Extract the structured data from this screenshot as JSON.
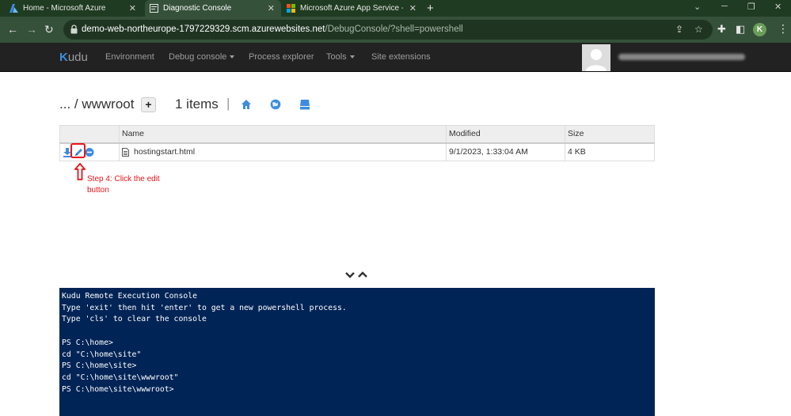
{
  "browser": {
    "tabs": [
      {
        "title": "Home - Microsoft Azure",
        "active": false
      },
      {
        "title": "Diagnostic Console",
        "active": true
      },
      {
        "title": "Microsoft Azure App Service - W",
        "active": false
      }
    ],
    "url_host": "demo-web-northeurope-1797229329.scm.azurewebsites.net",
    "url_path": "/DebugConsole/?shell=powershell",
    "profile_initial": "K"
  },
  "kudu_nav": {
    "brand_k": "K",
    "brand_rest": "udu",
    "links": [
      "Environment",
      "Debug console",
      "Process explorer",
      "Tools",
      "Site extensions"
    ]
  },
  "breadcrumb": {
    "path": "... / wwwroot",
    "items_count": "1 items"
  },
  "file_table": {
    "headers": [
      "",
      "Name",
      "Modified",
      "Size"
    ],
    "rows": [
      {
        "name": "hostingstart.html",
        "modified": "9/1/2023, 1:33:04 AM",
        "size": "4 KB"
      }
    ]
  },
  "annotation": {
    "text": "Step 4: Click the edit button",
    "color": "#e8141b"
  },
  "console": {
    "lines": [
      "Kudu Remote Execution Console",
      "Type 'exit' then hit 'enter' to get a new powershell process.",
      "Type 'cls' to clear the console",
      "",
      "PS C:\\home>",
      "cd \"C:\\home\\site\"",
      "PS C:\\home\\site>",
      "cd \"C:\\home\\site\\wwwroot\"",
      "PS C:\\home\\site\\wwwroot>"
    ]
  },
  "colors": {
    "browser_frame": "#35513a",
    "kudu_nav": "#222222",
    "console_bg": "#012456",
    "icon_blue": "#3c8dde"
  }
}
